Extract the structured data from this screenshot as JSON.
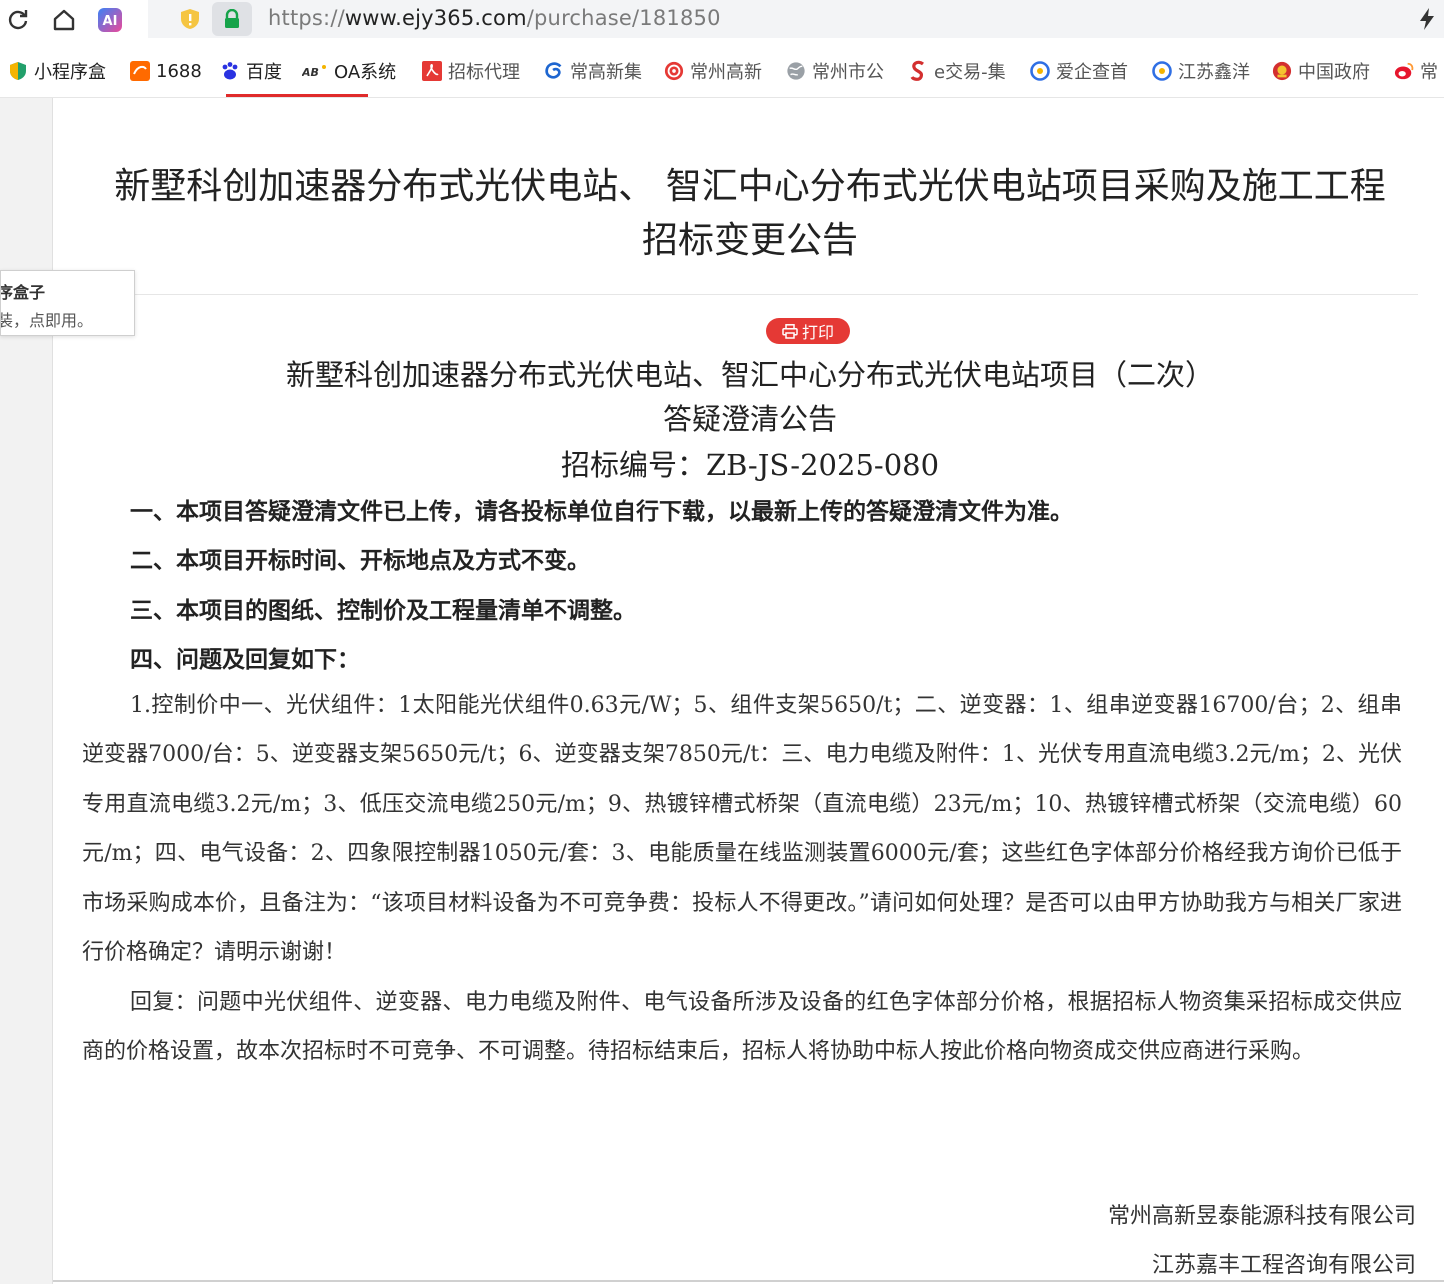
{
  "browser": {
    "url_scheme": "https://",
    "url_host": "www.ejy365.com",
    "url_path": "/purchase/181850",
    "bookmarks": [
      {
        "label": "小程序盒",
        "icon": "shield-leaf-icon"
      },
      {
        "label": "1688",
        "icon": "1688-logo-icon"
      },
      {
        "label": "百度",
        "icon": "baidu-paw-icon"
      },
      {
        "label": "OA系统",
        "icon": "oa-logo-icon"
      },
      {
        "label": "招标代理",
        "icon": "pdf-icon"
      },
      {
        "label": "常高新集",
        "icon": "swirl-icon"
      },
      {
        "label": "常州高新",
        "icon": "red-seal-icon"
      },
      {
        "label": "常州市公",
        "icon": "globe-icon"
      },
      {
        "label": "e交易-集",
        "icon": "red-s-icon"
      },
      {
        "label": "爱企查首",
        "icon": "search-e-icon"
      },
      {
        "label": "江苏鑫洋",
        "icon": "search-e-icon"
      },
      {
        "label": "中国政府",
        "icon": "national-emblem-icon"
      },
      {
        "label": "常",
        "icon": "weibo-icon"
      }
    ]
  },
  "popup": {
    "line1": "序盒子",
    "line2": "装，点即用。"
  },
  "page": {
    "title_line1": "新墅科创加速器分布式光伏电站、 智汇中心分布式光伏电站项目采购及施工工程",
    "title_line2": "招标变更公告",
    "print_label": "打印"
  },
  "document": {
    "title_line1": "新墅科创加速器分布式光伏电站、智汇中心分布式光伏电站项目（二次）",
    "title_line2": "答疑澄清公告",
    "tender_no": "招标编号：ZB-JS-2025-080",
    "points": [
      "一、本项目答疑澄清文件已上传，请各投标单位自行下载，以最新上传的答疑澄清文件为准。",
      "二、本项目开标时间、开标地点及方式不变。",
      "三、本项目的图纸、控制价及工程量清单不调整。",
      "四、问题及回复如下："
    ],
    "question": "1.控制价中一、光伏组件：1太阳能光伏组件0.63元/W；5、组件支架5650/t；二、逆变器：1、组串逆变器16700/台；2、组串逆变器7000/台：5、逆变器支架5650元/t；6、逆变器支架7850元/t：三、电力电缆及附件：1、光伏专用直流电缆3.2元/m；2、光伏专用直流电缆3.2元/m；3、低压交流电缆250元/m；9、热镀锌槽式桥架（直流电缆）23元/m；10、热镀锌槽式桥架（交流电缆）60元/m；四、电气设备：2、四象限控制器1050元/套：3、电能质量在线监测装置6000元/套；这些红色字体部分价格经我方询价已低于市场采购成本价，且备注为：“该项目材料设备为不可竞争费：投标人不得更改。”请问如何处理？是否可以由甲方协助我方与相关厂家进行价格确定？请明示谢谢！",
    "answer": "回复：问题中光伏组件、逆变器、电力电缆及附件、电气设备所涉及设备的红色字体部分价格，根据招标人物资集采招标成交供应商的价格设置，故本次招标时不可竞争、不可调整。待招标结束后，招标人将协助中标人按此价格向物资成交供应商进行采购。",
    "signature1": "常州高新昱泰能源科技有限公司",
    "signature2": "江苏嘉丰工程咨询有限公司"
  }
}
